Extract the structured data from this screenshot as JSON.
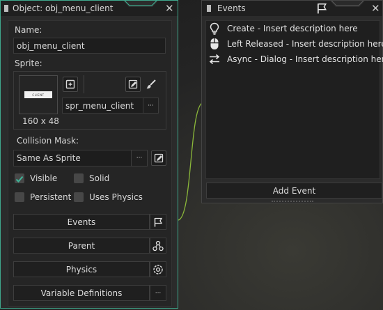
{
  "object_window": {
    "title": "Object: obj_menu_client",
    "close_symbol": "✕",
    "name_label": "Name:",
    "name_value": "obj_menu_client",
    "sprite_label": "Sprite:",
    "sprite_preview_text": "CLIENT",
    "sprite_size": "160 x 48",
    "sprite_name": "spr_menu_client",
    "more_symbol": "···",
    "collision_label": "Collision Mask:",
    "collision_value": "Same As Sprite",
    "checkboxes": [
      {
        "label": "Visible",
        "checked": true
      },
      {
        "label": "Solid",
        "checked": false
      },
      {
        "label": "Persistent",
        "checked": false
      },
      {
        "label": "Uses Physics",
        "checked": false
      }
    ],
    "buttons": {
      "events": "Events",
      "parent": "Parent",
      "physics": "Physics",
      "variables": "Variable Definitions"
    },
    "accent_color": "#3fa88c"
  },
  "events_window": {
    "title": "Events",
    "close_symbol": "✕",
    "events": [
      {
        "icon": "lightbulb-icon",
        "label": "Create - Insert description here"
      },
      {
        "icon": "mouse-icon",
        "label": "Left Released - Insert description here"
      },
      {
        "icon": "swap-arrows-icon",
        "label": "Async - Dialog - Insert description here"
      }
    ],
    "add_event_label": "Add Event"
  }
}
